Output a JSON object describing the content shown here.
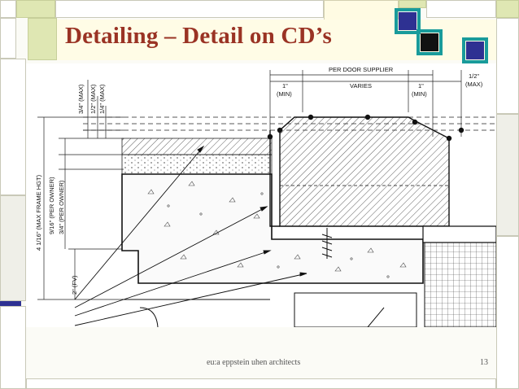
{
  "slide": {
    "title": "Detailing – Detail on CD’s",
    "footer": "eu:a   eppstein uhen architects",
    "page_number": "13"
  },
  "drawing": {
    "vertical_dims": [
      "3/4\" (MAX)",
      "1/2\" (MAX)",
      "1/4\" (MAX)",
      "4 1/16\" (MAX FRAME HGT)",
      "9/16\" (PER OWNER)",
      "3/4\" (PER OWNER)",
      "2\" (FV)"
    ],
    "top_dims": {
      "per_door_supplier": "PER DOOR SUPPLIER",
      "left_value": "1\"",
      "left_qualifier": "(MIN)",
      "varies": "VARIES",
      "right_value": "1\"",
      "right_qualifier": "(MIN)",
      "far_value": "1/2\"",
      "far_qualifier": "(MAX)"
    }
  },
  "colors": {
    "title": "#9a3324",
    "accent_navy": "#2e3192",
    "accent_teal": "#199b9b",
    "tile_green": "#dfe7b3",
    "tile_cream": "#fffbe3"
  }
}
